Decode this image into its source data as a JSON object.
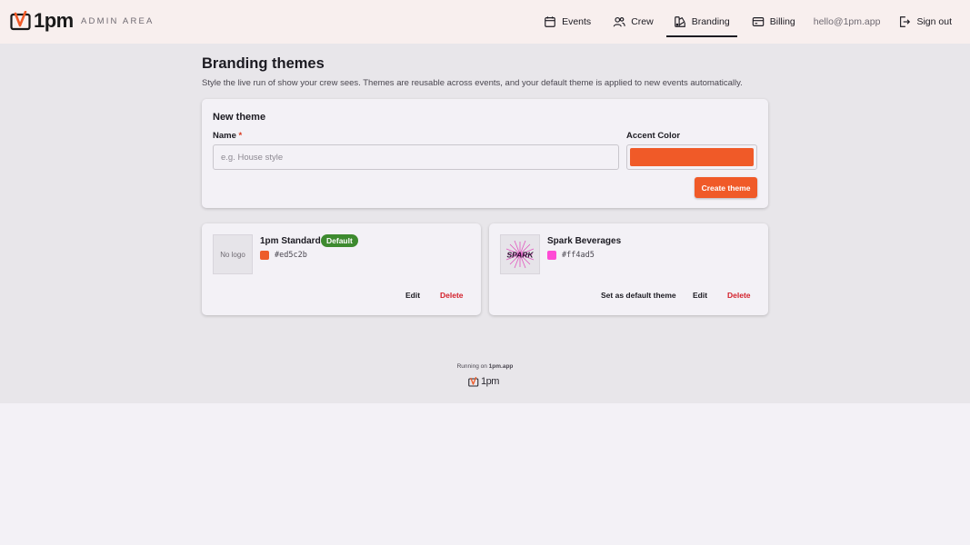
{
  "brand": {
    "name": "1pm",
    "area_label": "ADMIN AREA"
  },
  "nav": {
    "items": [
      {
        "label": "Events",
        "icon": "calendar-icon"
      },
      {
        "label": "Crew",
        "icon": "users-icon"
      },
      {
        "label": "Branding",
        "icon": "palette-icon",
        "active": true
      },
      {
        "label": "Billing",
        "icon": "credit-card-icon"
      }
    ],
    "email": "hello@1pm.app",
    "sign_out": "Sign out"
  },
  "page": {
    "title": "Branding themes",
    "subtitle": "Style the live run of show your crew sees. Themes are reusable across events, and your default theme is applied to new events automatically."
  },
  "new_theme": {
    "title": "New theme",
    "name_label": "Name",
    "required_mark": "*",
    "name_placeholder": "e.g. House style",
    "name_value": "",
    "accent_label": "Accent Color",
    "accent_value": "#f05a28",
    "create_label": "Create theme"
  },
  "themes": [
    {
      "name": "1pm Standard",
      "logo_text": "No logo",
      "badge": "Default",
      "hex": "#ed5c2b",
      "actions": {
        "edit": "Edit",
        "delete": "Delete"
      }
    },
    {
      "name": "Spark Beverages",
      "logo_text": "SPARK",
      "hex": "#ff4ad5",
      "actions": {
        "set_default": "Set as default theme",
        "edit": "Edit",
        "delete": "Delete"
      }
    }
  ],
  "footer": {
    "running_on": "Running on",
    "domain": "1pm.app",
    "logo_text": "1pm"
  },
  "colors": {
    "accent": "#f05a28",
    "header_bg": "#f8efee",
    "badge_green": "#3d8a2f",
    "delete_red": "#d31f2a"
  }
}
